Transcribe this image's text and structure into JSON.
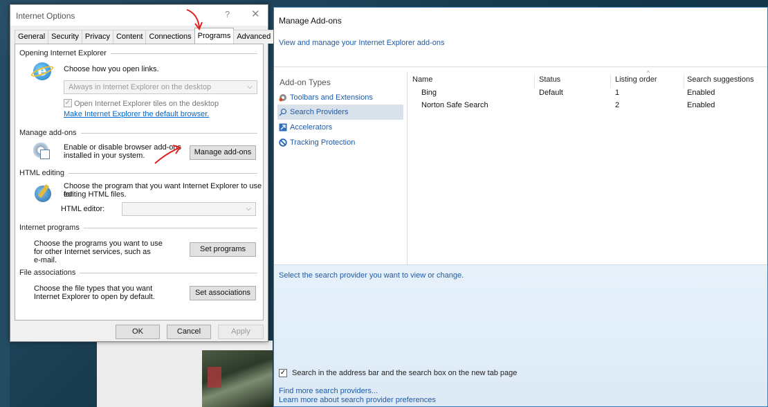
{
  "internet_options": {
    "title": "Internet Options",
    "help_glyph": "?",
    "close_glyph": "✕",
    "tabs": [
      "General",
      "Security",
      "Privacy",
      "Content",
      "Connections",
      "Programs",
      "Advanced"
    ],
    "active_tab": "Programs",
    "opening_ie": {
      "group_label": "Opening Internet Explorer",
      "choose_text": "Choose how you open links.",
      "combo_value": "Always in Internet Explorer on the desktop",
      "tiles_checkbox_label": "Open Internet Explorer tiles on the desktop",
      "tiles_checked": true,
      "default_link": "Make Internet Explorer the default browser."
    },
    "manage_addons": {
      "group_label": "Manage add-ons",
      "text_line1": "Enable or disable browser add-ons",
      "text_line2": "installed in your system.",
      "button": "Manage add-ons"
    },
    "html_editing": {
      "group_label": "HTML editing",
      "text_line1": "Choose the program that you want Internet Explorer to use for",
      "text_line2": "editing HTML files.",
      "editor_label": "HTML editor:",
      "editor_value": ""
    },
    "internet_programs": {
      "group_label": "Internet programs",
      "text_line1": "Choose the programs you want to use",
      "text_line2": "for other Internet services, such as",
      "text_line3": "e-mail.",
      "button": "Set programs"
    },
    "file_associations": {
      "group_label": "File associations",
      "text_line1": "Choose the file types that you want",
      "text_line2": "Internet Explorer to open by default.",
      "button": "Set associations"
    },
    "footer": {
      "ok": "OK",
      "cancel": "Cancel",
      "apply": "Apply"
    }
  },
  "manage_addons_window": {
    "title": "Manage Add-ons",
    "subtitle": "View and manage your Internet Explorer add-ons",
    "sidebar": {
      "heading": "Add-on Types",
      "items": [
        {
          "label": "Toolbars and Extensions",
          "icon": "gear-icon"
        },
        {
          "label": "Search Providers",
          "icon": "search-icon"
        },
        {
          "label": "Accelerators",
          "icon": "accelerator-icon"
        },
        {
          "label": "Tracking Protection",
          "icon": "blocked-icon"
        }
      ],
      "selected_index": 1
    },
    "columns": [
      "Name",
      "Status",
      "Listing order",
      "Search suggestions"
    ],
    "rows": [
      {
        "name": "Bing",
        "status": "Default",
        "order": "1",
        "suggestions": "Enabled"
      },
      {
        "name": "Norton Safe Search",
        "status": "",
        "order": "2",
        "suggestions": "Enabled"
      }
    ],
    "details_prompt": "Select the search provider you want to view or change.",
    "address_bar_checkbox": {
      "label": "Search in the address bar and the search box on the new tab page",
      "checked": true
    },
    "find_more_link": "Find more search providers...",
    "learn_more_link": "Learn more about search provider preferences"
  },
  "colors": {
    "annotation_red": "#e02020",
    "link_blue": "#1e5aa8",
    "window_border": "#3a7bc0",
    "details_bg": "#e6f1fa"
  }
}
